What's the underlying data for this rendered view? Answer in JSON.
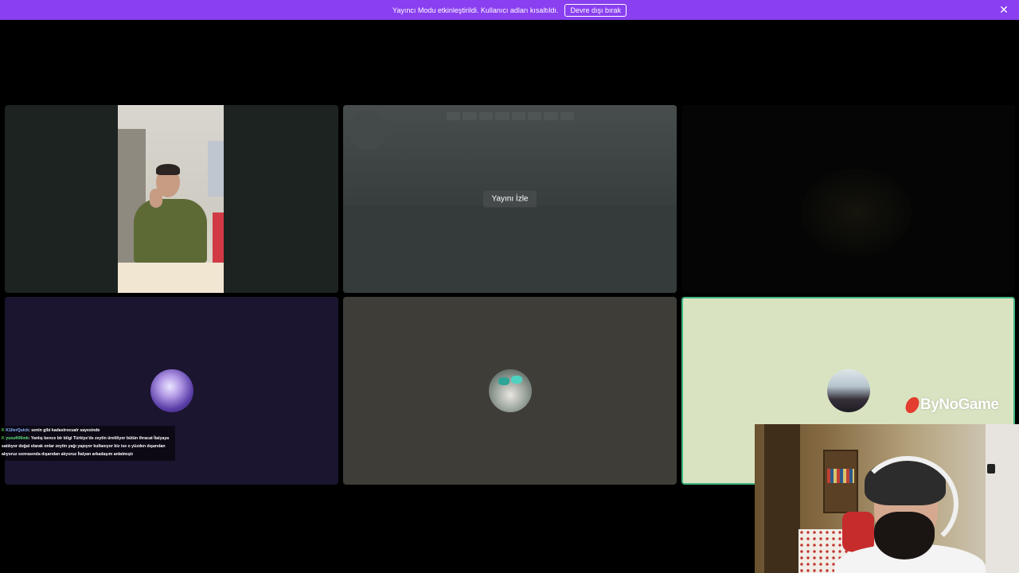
{
  "banner": {
    "message": "Yayıncı Modu etkinleştirildi. Kullanıcı adları kısaltıldı.",
    "disable_label": "Devre dışı bırak",
    "close_icon": "close-icon",
    "color": "#8a3ff0"
  },
  "tiles": {
    "stream": {
      "watch_label": "Yayını İzle"
    }
  },
  "chat": {
    "messages": [
      {
        "user": "K1llerQuick",
        "text": ": senin gibi kadastrocualr sayesinde"
      },
      {
        "user": "yusufi06mk",
        "text": ": Yanlış bence bir bilgi Türkiye'de zeytin üretiliyor bütün ihracat İtalyaya satılıyor doğal olarak onlar zeytin yağı yapıyor kullanıyor biz ise o yüzden dışarıdan alıyoruz sonrasında dışarıdan alıyoruz İtalyan arkadaşım anlatmıştı"
      }
    ]
  },
  "watermark": {
    "text": "ByNoGame"
  },
  "colors": {
    "active_speaker_border": "#43b581",
    "background": "#000000"
  }
}
